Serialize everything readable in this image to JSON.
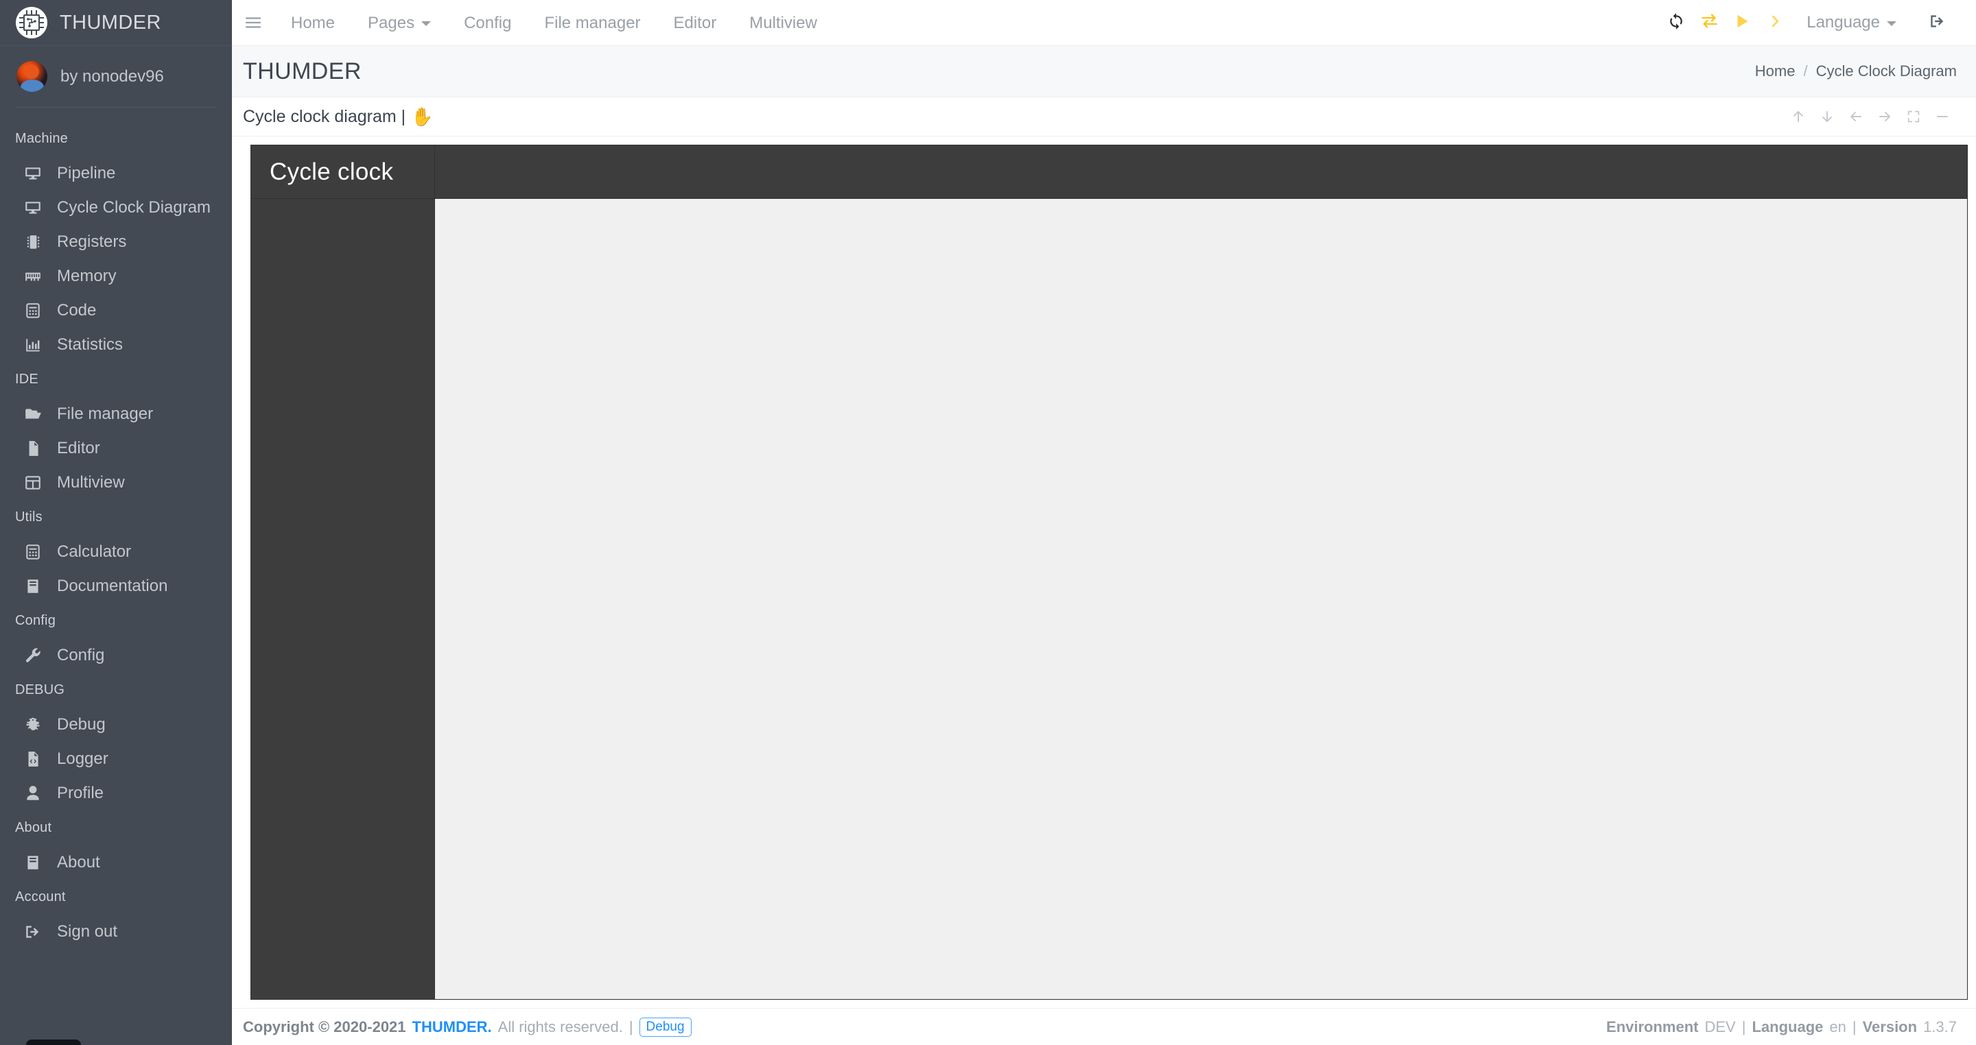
{
  "sidebar": {
    "brand": {
      "name": "THUMDER",
      "logo_icon": "cpu-chip-logo-icon"
    },
    "user": {
      "name": "by nonodev96",
      "avatar_icon": "user-avatar"
    },
    "sections": [
      {
        "header": "Machine",
        "items": [
          {
            "label": "Pipeline",
            "icon": "desktop-icon"
          },
          {
            "label": "Cycle Clock Diagram",
            "icon": "desktop-icon"
          },
          {
            "label": "Registers",
            "icon": "memory-chip-icon"
          },
          {
            "label": "Memory",
            "icon": "ram-stick-icon"
          },
          {
            "label": "Code",
            "icon": "calculator-icon"
          },
          {
            "label": "Statistics",
            "icon": "bar-chart-icon"
          }
        ]
      },
      {
        "header": "IDE",
        "items": [
          {
            "label": "File manager",
            "icon": "folder-open-icon"
          },
          {
            "label": "Editor",
            "icon": "file-icon"
          },
          {
            "label": "Multiview",
            "icon": "table-grid-icon"
          }
        ]
      },
      {
        "header": "Utils",
        "items": [
          {
            "label": "Calculator",
            "icon": "calculator-icon"
          },
          {
            "label": "Documentation",
            "icon": "book-icon"
          }
        ]
      },
      {
        "header": "Config",
        "items": [
          {
            "label": "Config",
            "icon": "wrench-icon"
          }
        ]
      },
      {
        "header": "DEBUG",
        "items": [
          {
            "label": "Debug",
            "icon": "bug-icon"
          },
          {
            "label": "Logger",
            "icon": "file-code-icon"
          },
          {
            "label": "Profile",
            "icon": "user-icon"
          }
        ]
      },
      {
        "header": "About",
        "items": [
          {
            "label": "About",
            "icon": "book-icon"
          }
        ]
      },
      {
        "header": "Account",
        "items": [
          {
            "label": "Sign out",
            "icon": "sign-out-icon"
          }
        ]
      }
    ]
  },
  "topbar": {
    "menu_icon": "hamburger-menu-icon",
    "nav": [
      {
        "label": "Home",
        "has_caret": false
      },
      {
        "label": "Pages",
        "has_caret": true
      },
      {
        "label": "Config",
        "has_caret": false
      },
      {
        "label": "File manager",
        "has_caret": false
      },
      {
        "label": "Editor",
        "has_caret": false
      },
      {
        "label": "Multiview",
        "has_caret": false
      }
    ],
    "actions": [
      {
        "icon": "refresh-icon",
        "color": "#2b2f33"
      },
      {
        "icon": "exchange-arrows-icon",
        "color": "#fcc419"
      },
      {
        "icon": "play-icon",
        "color": "#ffd24d"
      },
      {
        "icon": "chevron-right-icon",
        "color": "#ffd24d"
      }
    ],
    "language_label": "Language",
    "logout_icon": "sign-out-icon"
  },
  "page": {
    "title": "THUMDER",
    "breadcrumb": {
      "home": "Home",
      "separator": "/",
      "current": "Cycle Clock Diagram"
    }
  },
  "card": {
    "title": "Cycle clock diagram |",
    "hand_icon": "hand-grab-icon",
    "tools": [
      {
        "icon": "arrow-up-icon"
      },
      {
        "icon": "arrow-down-icon"
      },
      {
        "icon": "arrow-left-icon"
      },
      {
        "icon": "arrow-right-icon"
      },
      {
        "icon": "expand-fullscreen-icon"
      },
      {
        "icon": "minimize-icon"
      }
    ]
  },
  "diagram": {
    "corner_label": "Cycle clock",
    "header_bg": "#3d3d3d",
    "body_bg": "#f0f0f0"
  },
  "footer": {
    "copyright_prefix": "Copyright © 2020-2021",
    "brand": "THUMDER.",
    "rights": "All rights reserved.",
    "pipe": "|",
    "debug_label": "Debug",
    "env_label": "Environment",
    "env_value": "DEV",
    "pipe2": "|",
    "lang_label": "Language",
    "lang_value": "en",
    "pipe3": "|",
    "version_label": "Version",
    "version_value": "1.3.7"
  }
}
